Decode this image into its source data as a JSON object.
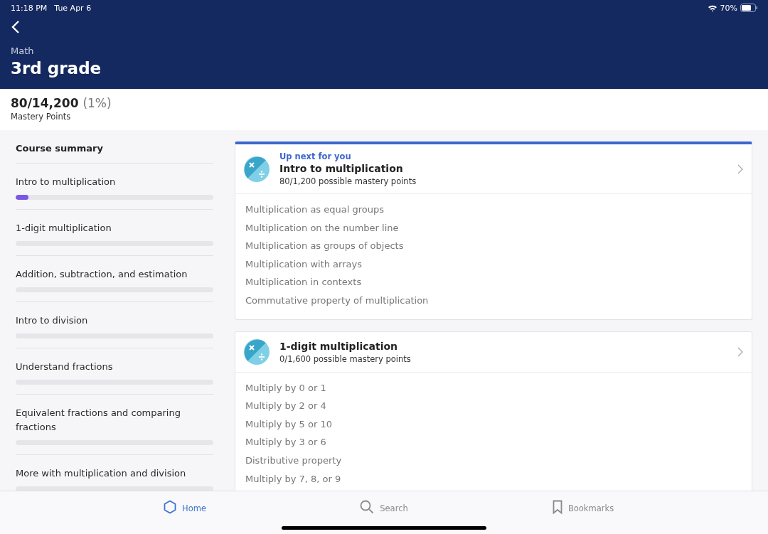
{
  "status_bar": {
    "time": "11:18 PM",
    "date": "Tue Apr 6",
    "battery": "70%"
  },
  "header": {
    "subject": "Math",
    "title": "3rd grade"
  },
  "mastery": {
    "points": "80/14,200",
    "percent": "(1%)",
    "label": "Mastery Points"
  },
  "sidebar": {
    "title": "Course summary",
    "items": [
      {
        "label": "Intro to multiplication",
        "level": 0.065
      },
      {
        "label": "1-digit multiplication",
        "level": 0
      },
      {
        "label": "Addition, subtraction, and estimation",
        "level": 0
      },
      {
        "label": "Intro to division",
        "level": 0
      },
      {
        "label": "Understand fractions",
        "level": 0
      },
      {
        "label": "Equivalent fractions and comparing fractions",
        "level": 0
      },
      {
        "label": "More with multiplication and division",
        "level": 0
      }
    ]
  },
  "units": [
    {
      "up_next": "Up next for you",
      "title": "Intro to multiplication",
      "points": "80/1,200 possible mastery points",
      "lessons": [
        "Multiplication as equal groups",
        "Multiplication on the number line",
        "Multiplication as groups of objects",
        "Multiplication with arrays",
        "Multiplication in contexts",
        "Commutative property of multiplication"
      ]
    },
    {
      "title": "1-digit multiplication",
      "points": "0/1,600 possible mastery points",
      "lessons": [
        "Multiply by 0 or 1",
        "Multiply by 2 or 4",
        "Multiply by 5 or 10",
        "Multiply by 3 or 6",
        "Distributive property",
        "Multiply by 7, 8, or 9"
      ]
    }
  ],
  "tabs": [
    {
      "label": "Home",
      "kind": "home",
      "selected": true
    },
    {
      "label": "Search",
      "kind": "search",
      "selected": false
    },
    {
      "label": "Bookmarks",
      "kind": "bookmarks",
      "selected": false
    }
  ]
}
